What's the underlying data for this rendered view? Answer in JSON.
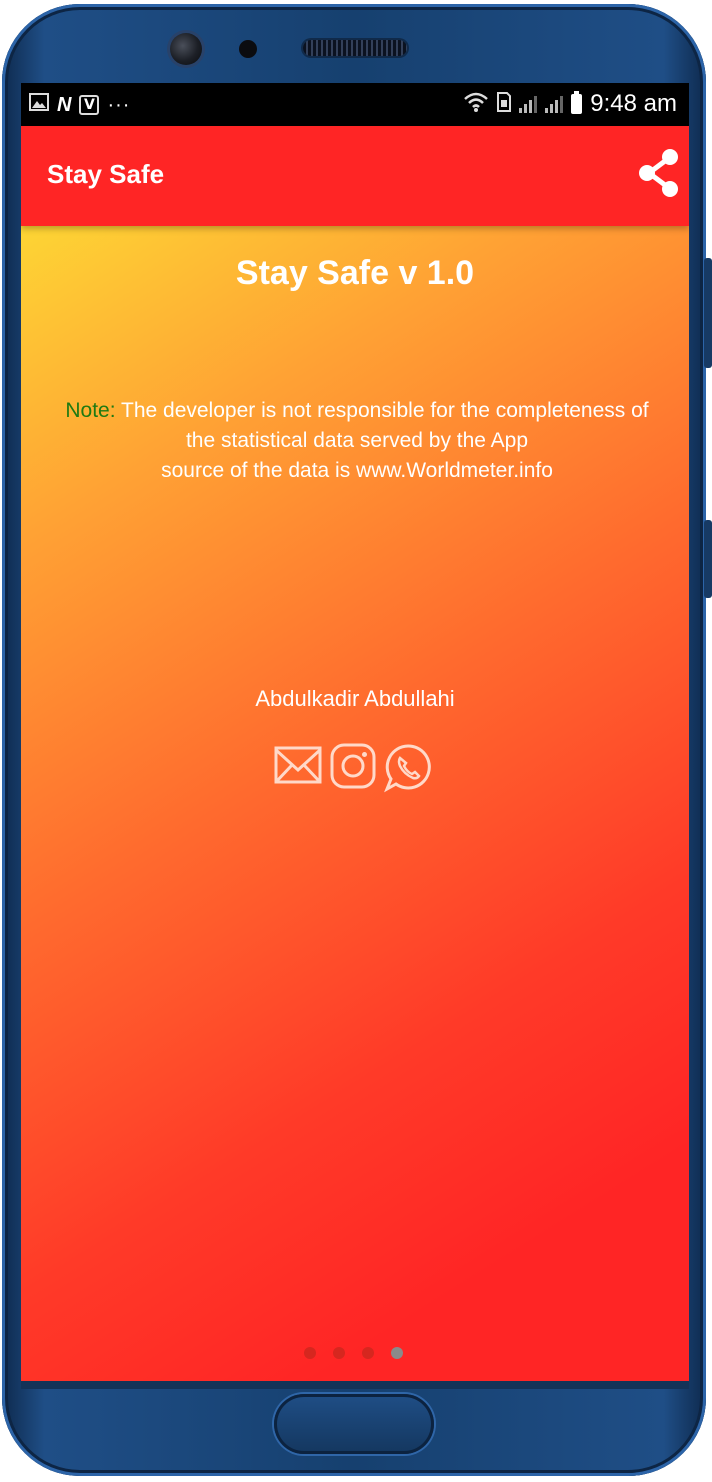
{
  "status_bar": {
    "left_icons": [
      "image-icon",
      "n-icon",
      "v-icon",
      "more-dots-icon"
    ],
    "n_glyph": "N",
    "v_glyph": "V",
    "dots": "···",
    "time": "9:48 am"
  },
  "app_bar": {
    "title": "Stay Safe",
    "share_icon": "share-icon"
  },
  "main": {
    "version_title": "Stay Safe v 1.0",
    "note_label": "Note:",
    "note_text_line1": " The developer is not responsible for the completeness of",
    "note_text_line2": "the statistical data served by the App",
    "note_text_line3": "source of the data is www.Worldmeter.info",
    "author": "Abdulkadir Abdullahi",
    "social_icons": [
      "mail-icon",
      "instagram-icon",
      "whatsapp-icon"
    ],
    "pager": {
      "count": 4,
      "active_index": 3
    }
  },
  "colors": {
    "app_bar": "#ff2525",
    "gradient_top": "#fdd534",
    "gradient_mid": "#ff6a2e",
    "gradient_bottom": "#ff2525",
    "note_label": "#1f7a12",
    "phone_body": "#1f4e86"
  }
}
